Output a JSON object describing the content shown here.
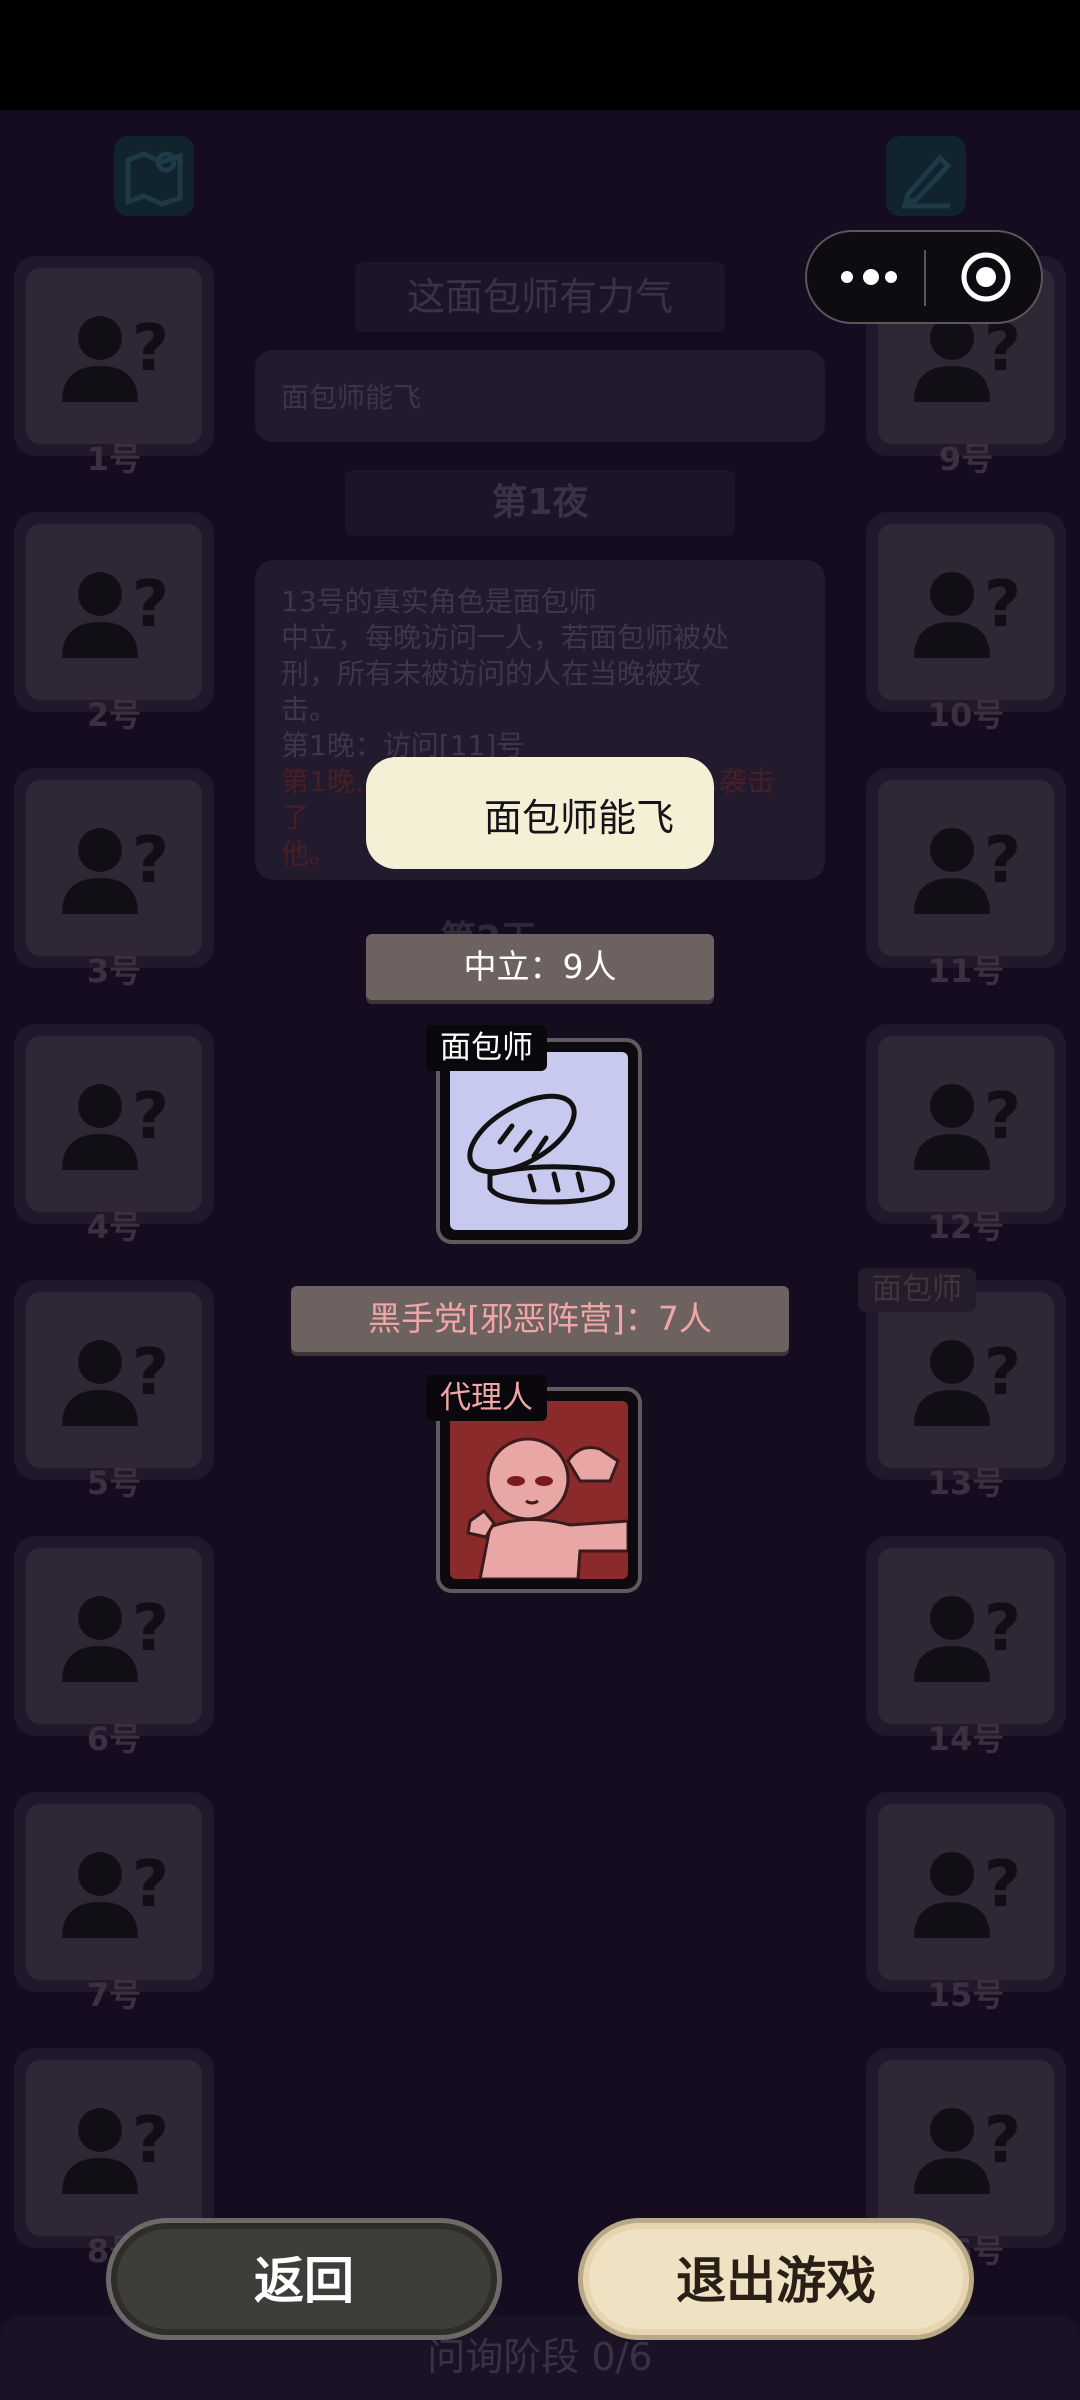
{
  "header": {
    "map_icon": "map-icon",
    "edit_icon": "edit-icon",
    "capsule": {
      "more_icon": "more-dots-icon",
      "close_icon": "target-close-icon"
    }
  },
  "background": {
    "title": "这面包师有力气",
    "input_value": "面包师能飞",
    "night_label": "第1夜",
    "panel_lines": [
      "13号的真实角色是面包师",
      "中立，每晚访问一人，若面包师被处",
      "刑，所有未被访问的人在当晚被攻",
      "击。",
      "第1晚：访问[11]号"
    ],
    "panel_red": "第1晚…………………………………袭击了",
    "panel_red2": "他。",
    "day_label": "第2天",
    "status": "问询阶段 0/6",
    "players_left": [
      "1号",
      "2号",
      "3号",
      "4号",
      "5号",
      "6号",
      "7号",
      "8号"
    ],
    "players_right": [
      "9号",
      "10号",
      "11号",
      "12号",
      "13号",
      "14号",
      "15号",
      "16号"
    ],
    "slot13_role": "面包师"
  },
  "popup": {
    "speech": "面包师能飞",
    "neutral_header": "中立：9人",
    "neutral_role": "面包师",
    "evil_header": "黑手党[邪恶阵营]：7人",
    "evil_role": "代理人"
  },
  "buttons": {
    "back": "返回",
    "exit": "退出游戏"
  }
}
